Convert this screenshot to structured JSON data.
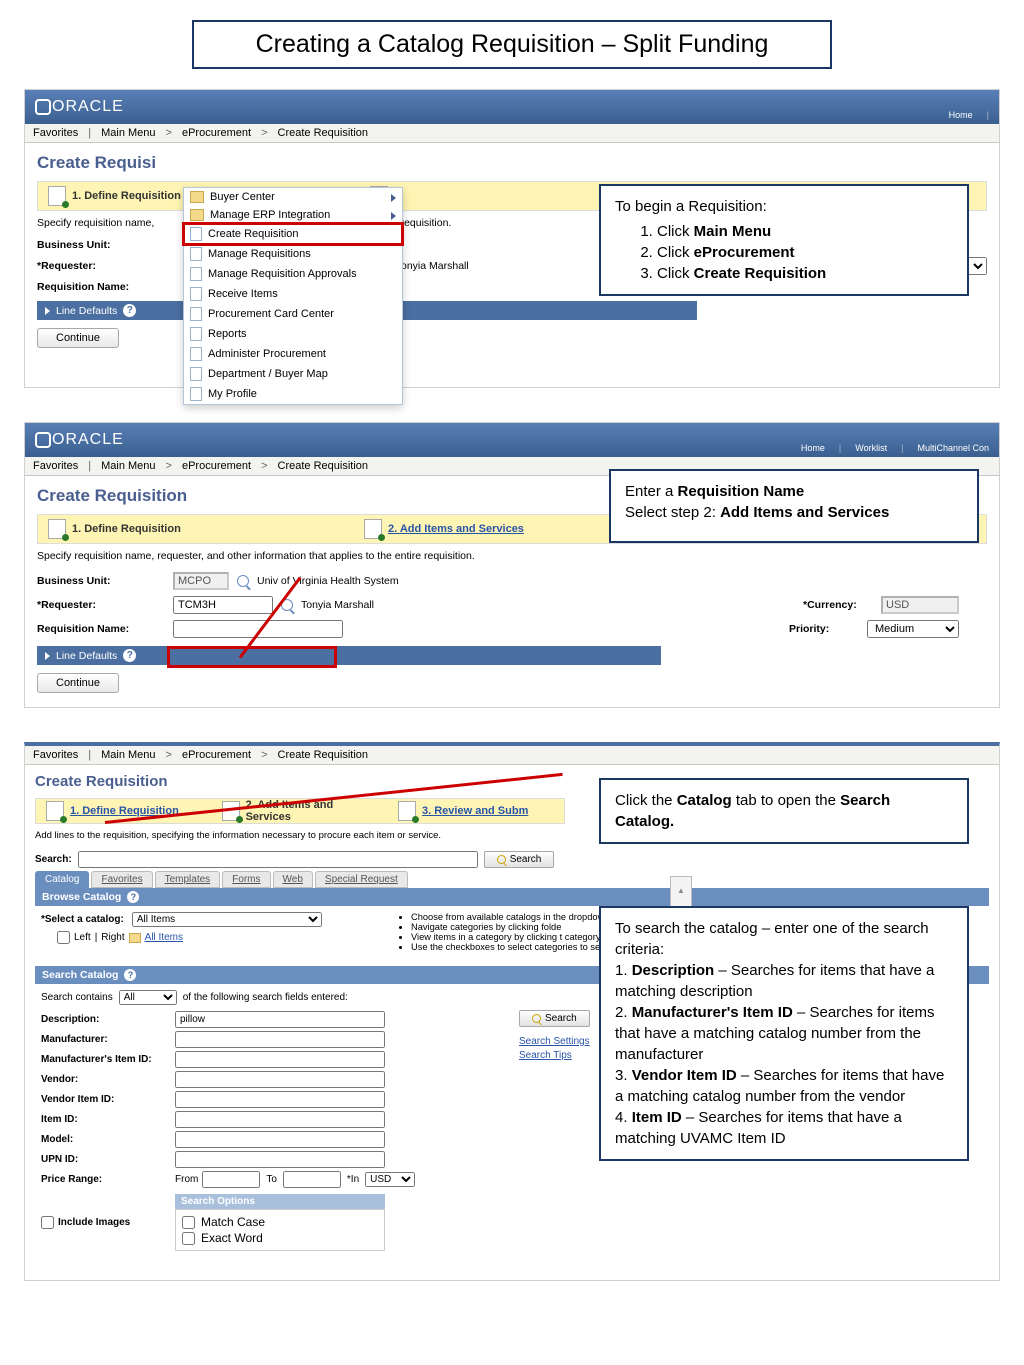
{
  "page_title": "Creating a Catalog Requisition – Split Funding",
  "oracle_brand": "ORACLE",
  "toplinks": {
    "home": "Home",
    "worklist": "Worklist",
    "multi": "MultiChannel Con"
  },
  "breadcrumb": {
    "fav": "Favorites",
    "mm": "Main Menu",
    "ep": "eProcurement",
    "cr": "Create Requisition"
  },
  "cr_heading_full": "Create Requisition",
  "steps": {
    "s1": "1. Define Requisition",
    "s2": "2. Add Items and Services",
    "s3": "3. Review and Subm",
    "s2short": "Services"
  },
  "subnote": "Specify requisition name, requester, and other information that applies to the entire requisition.",
  "subnote_partial": "ntire requisition.",
  "labels": {
    "bu": "Business Unit:",
    "req": "*Requester:",
    "rn": "Requisition Name:",
    "currency": "*Currency:",
    "priority": "Priority:",
    "requester_name": "Tonyia Marshall",
    "requester_name_partial": "onyia Marshall"
  },
  "values": {
    "bu": "MCPO",
    "bu_desc": "Univ of Virginia Health System",
    "req": "TCM3H",
    "currency": "USD",
    "priority": "Medium"
  },
  "line_defaults": "Line Defaults",
  "continue": "Continue",
  "menu": [
    {
      "label": "Buyer Center",
      "icon": "f",
      "sub": true
    },
    {
      "label": "Manage ERP Integration",
      "icon": "f",
      "sub": true
    },
    {
      "label": "Create Requisition",
      "icon": "d",
      "hl": true
    },
    {
      "label": "Manage Requisitions",
      "icon": "d"
    },
    {
      "label": "Manage Requisition Approvals",
      "icon": "d"
    },
    {
      "label": "Receive Items",
      "icon": "d"
    },
    {
      "label": "Procurement Card Center",
      "icon": "d"
    },
    {
      "label": "Reports",
      "icon": "d"
    },
    {
      "label": "Administer Procurement",
      "icon": "d"
    },
    {
      "label": "Department / Buyer Map",
      "icon": "d"
    },
    {
      "label": "My Profile",
      "icon": "d"
    }
  ],
  "callout1": {
    "intro": "To begin a Requisition:",
    "i1": "Click ",
    "b1": "Main Menu",
    "i2": "Click ",
    "b2": "eProcurement",
    "i3": "Click ",
    "b3": "Create Requisition"
  },
  "callout2": {
    "l1a": "Enter a ",
    "l1b": "Requisition Name",
    "l2a": "Select step 2: ",
    "l2b": "Add Items and Services"
  },
  "callout3": {
    "a": "Click the ",
    "b": "Catalog",
    "c": " tab to open the ",
    "d": "Search Catalog."
  },
  "callout4": {
    "intro": "To search the catalog – enter one of the search criteria:",
    "l1": "1. ",
    "b1": "Description",
    "t1": " – Searches for items that have a matching description",
    "l2": "2. ",
    "b2": "Manufacturer's Item ID",
    "t2": " – Searches for items that have a matching catalog number from the manufacturer",
    "l3": "3. ",
    "b3": "Vendor Item ID",
    "t3": " – Searches for items that have a matching catalog number from the vendor",
    "l4": "4. ",
    "b4": "Item ID",
    "t4": " – Searches for items that have a matching UVAMC Item ID"
  },
  "s3": {
    "add_note": "Add lines to the requisition, specifying the information necessary to procure each item or service.",
    "search_lbl": "Search:",
    "search_btn": "Search",
    "tabs": [
      "Catalog",
      "Favorites",
      "Templates",
      "Forms",
      "Web",
      "Special Request"
    ],
    "browse": "Browse Catalog",
    "sel_cat": "*Select a catalog:",
    "all_items": "All Items",
    "left": "Left",
    "right": "Right",
    "all_link": "All Items",
    "tips": [
      "Choose from available catalogs in the dropdown list",
      "Navigate categories by clicking folde",
      "View items in a category by clicking t category name",
      "Use the checkboxes to select categories to search below"
    ],
    "search_cat": "Search Catalog",
    "contains_lbl": "Search contains",
    "contains_val": "All",
    "contains_txt": "of the following search fields entered:",
    "fields": {
      "desc": "Description:",
      "man": "Manufacturer:",
      "manid": "Manufacturer's Item ID:",
      "ven": "Vendor:",
      "venid": "Vendor Item ID:",
      "item": "Item ID:",
      "model": "Model:",
      "upn": "UPN ID:",
      "price": "Price Range:"
    },
    "desc_val": "pillow",
    "from": "From",
    "to": "To",
    "in": "*In",
    "usd": "USD",
    "include": "Include Images",
    "so": "Search Options",
    "mc": "Match Case",
    "ew": "Exact Word",
    "ss": "Search Settings",
    "st": "Search Tips"
  }
}
